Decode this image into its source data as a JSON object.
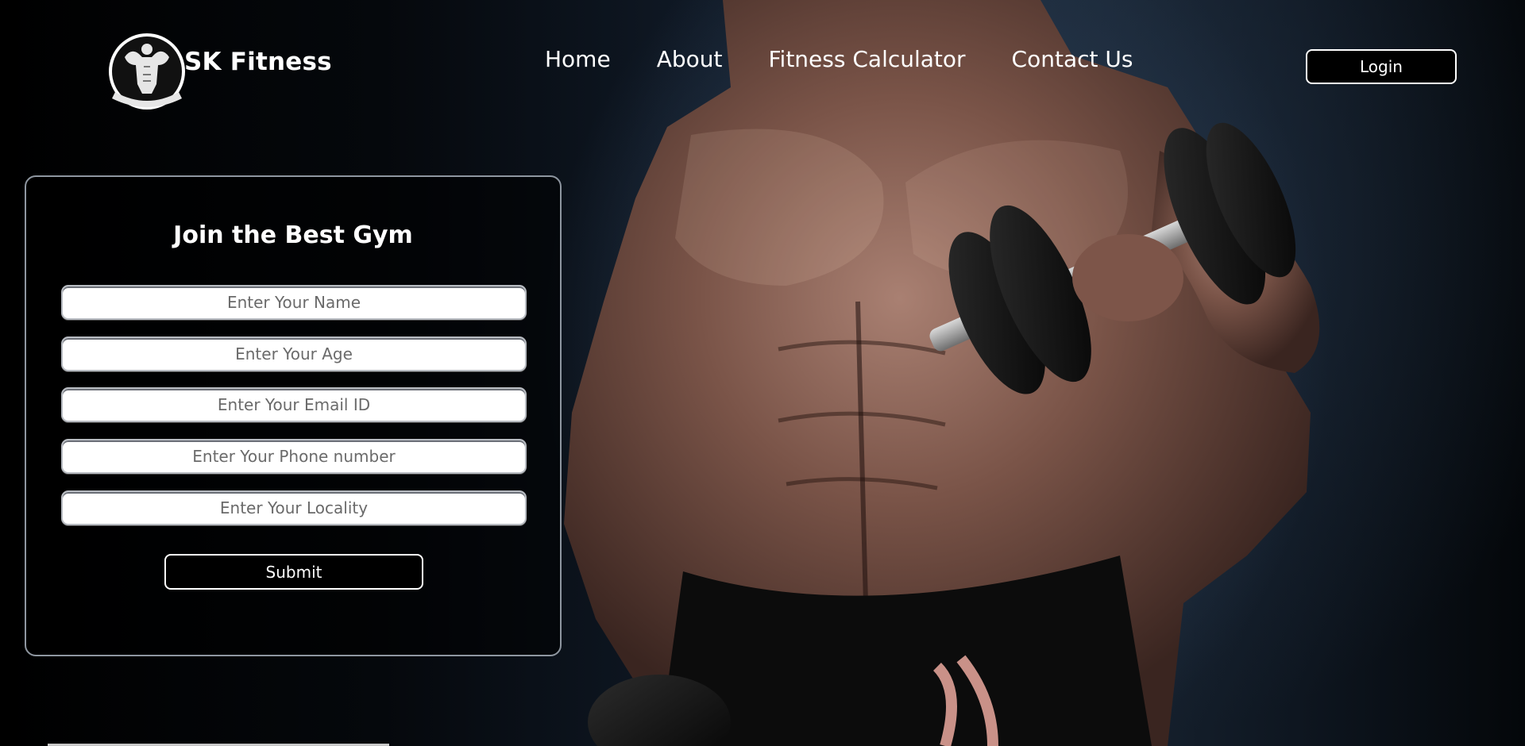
{
  "header": {
    "brand": "SK Fitness",
    "nav": [
      {
        "label": "Home"
      },
      {
        "label": "About"
      },
      {
        "label": "Fitness Calculator"
      },
      {
        "label": "Contact Us"
      }
    ],
    "login_label": "Login"
  },
  "form": {
    "title": "Join the Best Gym",
    "fields": [
      {
        "placeholder": "Enter Your Name",
        "value": ""
      },
      {
        "placeholder": "Enter Your Age",
        "value": ""
      },
      {
        "placeholder": "Enter Your Email ID",
        "value": ""
      },
      {
        "placeholder": "Enter Your Phone number",
        "value": ""
      },
      {
        "placeholder": "Enter Your Locality",
        "value": ""
      }
    ],
    "submit_label": "Submit"
  },
  "icons": {
    "logo": "bodybuilder-logo-icon"
  },
  "colors": {
    "background": "#000000",
    "text": "#ffffff",
    "card_border": "#8e96a0",
    "button_bg": "#000000"
  }
}
